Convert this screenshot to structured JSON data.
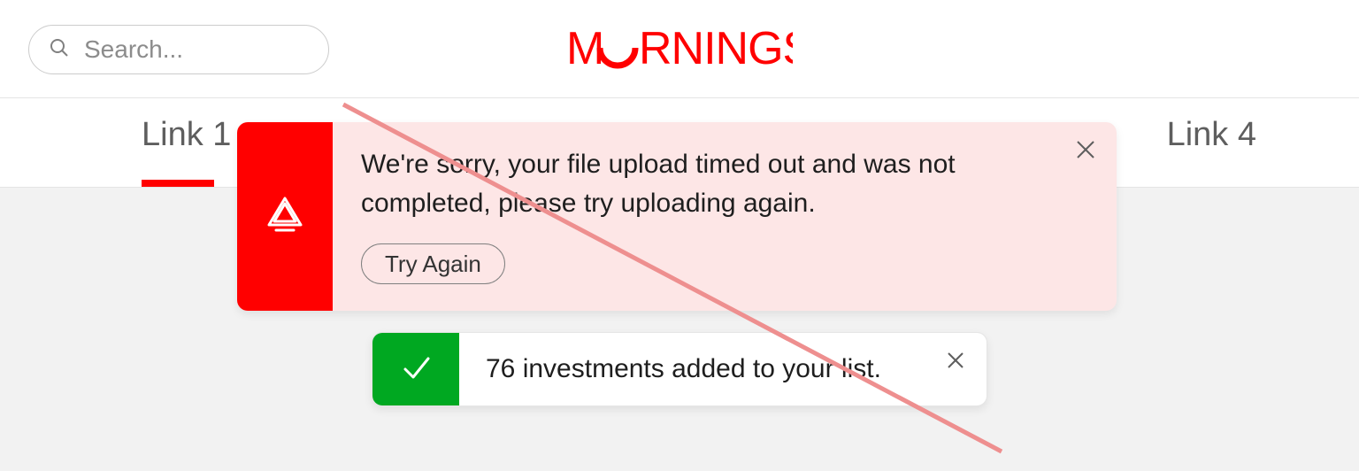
{
  "header": {
    "search_placeholder": "Search...",
    "brand": "MORNINGSTAR"
  },
  "nav": {
    "link1": "Link 1",
    "link4": "Link 4"
  },
  "notifications": {
    "error": {
      "message": "We're sorry, your file upload timed out and was not completed, please try uploading again.",
      "action": "Try Again"
    },
    "success": {
      "message": "76 investments added to your list."
    }
  },
  "colors": {
    "brand_red": "#ff0000",
    "success_green": "#00a821",
    "error_bg": "#fde6e6"
  }
}
